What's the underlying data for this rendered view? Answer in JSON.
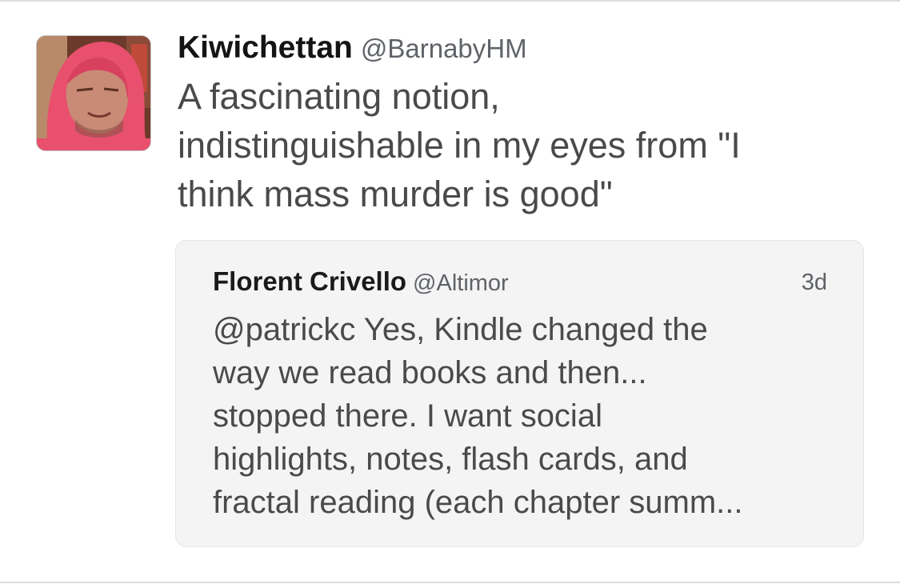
{
  "tweet": {
    "author": {
      "name": "Kiwichettan",
      "handle": "@BarnabyHM",
      "avatar_icon": "user-avatar-pink-hoodie"
    },
    "text": "A fascinating notion,\nindistinguishable in my eyes from \"I\nthink mass murder is good\""
  },
  "quoted_tweet": {
    "author": {
      "name": "Florent Crivello",
      "handle": "@Altimor"
    },
    "time": "3d",
    "text": "@patrickc Yes, Kindle changed the\nway we read books and then...\nstopped there. I want social\nhighlights, notes, flash cards, and\nfractal reading (each chapter summ..."
  },
  "colors": {
    "background": "#ffffff",
    "card_background": "#f4f4f4",
    "name_text": "#141414",
    "handle_text": "#5f6368",
    "body_text": "#4a4a4a",
    "avatar_hoodie": "#e8506e"
  }
}
